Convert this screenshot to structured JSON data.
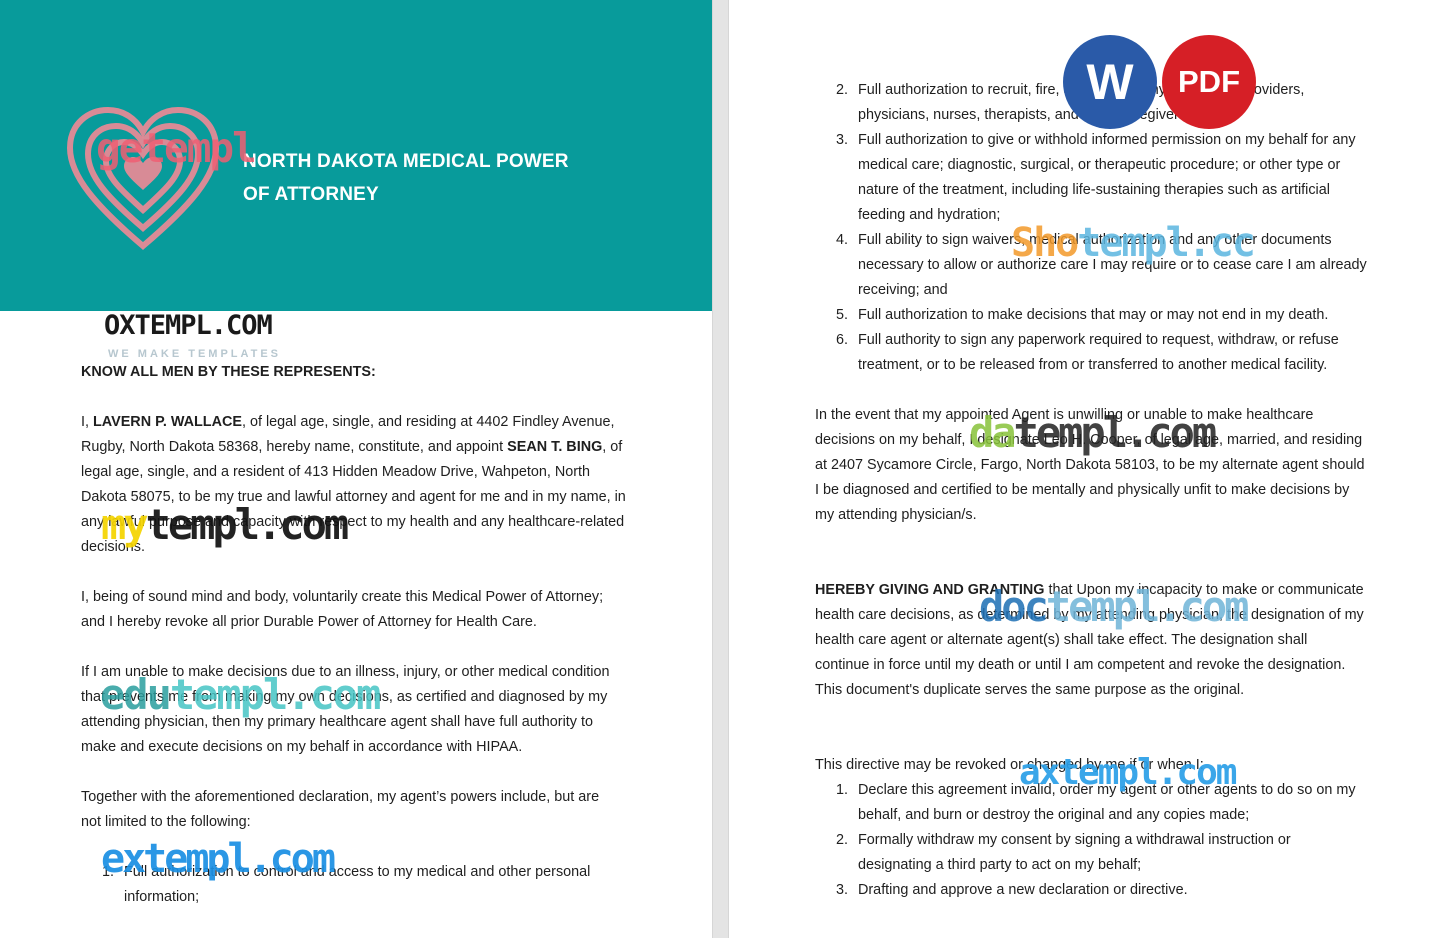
{
  "title": {
    "line1": "NORTH DAKOTA MEDICAL POWER",
    "line2": "OF ATTORNEY"
  },
  "left": {
    "heading": "KNOW ALL MEN BY THESE REPRESENTS:",
    "p1": {
      "a": "I, ",
      "principal": "LAVERN P. WALLACE",
      "b": ", of legal age, single, and residing at 4402 Findley Avenue, Rugby, North Dakota 58368, hereby name, constitute, and appoint ",
      "agent": "SEAN T. BING",
      "c": ", of legal age, single, and a resident of 413 Hidden Meadow Drive, Wahpeton, North Dakota 58075, to be my true and lawful attorney and agent for me and in my name, in any lawful purpose and capacity with respect to my health and any healthcare-related decisions."
    },
    "p2": "I, being of sound mind and body, voluntarily create this Medical Power of Attorney; and I hereby revoke all prior Durable Power of Attorney for Health Care.",
    "p3": "If I am unable to make decisions due to an illness, injury, or other medical condition that prevents me from making my own decisions, as certified and diagnosed by my attending physician, then my primary healthcare agent shall have full authority to make and execute decisions on my behalf in accordance with HIPAA.",
    "p4": "Together with the aforementioned declaration, my agent’s powers include, but are not limited to the following:",
    "list": [
      {
        "num": "1.",
        "text": "Full authorization to control and access to my medical and other personal information;"
      }
    ]
  },
  "right": {
    "list1": [
      {
        "num": "2.",
        "text": "Full authorization to recruit, fire, and oversee my healthcare providers, physicians, nurses, therapists, and other caregivers;"
      },
      {
        "num": "3.",
        "text": "Full authorization to give or withhold informed permission on my behalf for any medical care; diagnostic, surgical, or therapeutic procedure; or other type or nature of the treatment, including life-sustaining therapies such as artificial feeding and hydration;"
      },
      {
        "num": "4.",
        "text": "Full ability to sign waivers, medical authorization and any other documents necessary to allow or authorize care I may require or to cease care I am already receiving; and"
      },
      {
        "num": "5.",
        "text": "Full authorization to make decisions that may or may not end in my death."
      },
      {
        "num": "6.",
        "text": "Full authority to sign any paperwork required to request, withdraw, or refuse treatment, or to be released from or transferred to another medical facility."
      }
    ],
    "p5": "In the event that my appointed Agent is unwilling or unable to make healthcare decisions on my behalf, I designate Leo H. Cooper, of legal age, married, and residing at 2407 Sycamore Circle, Fargo, North Dakota 58103, to be my alternate agent should I be diagnosed and certified to be mentally and physically unfit to make decisions by my attending physician/s.",
    "p6": {
      "bold": "HEREBY GIVING AND GRANTING",
      "rest": " that Upon my incapacity to make or communicate health care decisions, as determined by my attending physician, the designation of my health care agent or alternate agent(s) shall take effect. The designation shall continue in force until my death or until I am competent and revoke the designation. This document's duplicate serves the same purpose as the original."
    },
    "p7": "This directive may be revoked or changed by me if or when I:",
    "list2": [
      {
        "num": "1.",
        "text": "Declare this agreement invalid, order my agent or other agents to do so on my behalf, and burn or destroy the original and any copies made;"
      },
      {
        "num": "2.",
        "text": "Formally withdraw my consent by signing a withdrawal instruction or designating a third party to act on my behalf;"
      },
      {
        "num": "3.",
        "text": "Drafting and approve a new declaration or directive."
      }
    ]
  },
  "watermarks": {
    "getempl": {
      "a": "ge",
      "b": "templ"
    },
    "oxtempl": "OXTEMPL.COM",
    "oxtempl_sub": "WE MAKE TEMPLATES",
    "mytempl": {
      "a": "my",
      "b": "templ.com"
    },
    "edutempl": {
      "a": "edu",
      "b": "templ.com"
    },
    "extempl": {
      "a": "ex",
      "b": "templ.com"
    },
    "shotempl": {
      "a": "Sho",
      "b": "templ.cc"
    },
    "datempl": {
      "a": "da",
      "b": "templ.com"
    },
    "doctempl": {
      "a": "doc",
      "b": "templ.com"
    },
    "axtempl": "axtempl.com"
  },
  "badges": {
    "word": "W",
    "pdf": "PDF"
  },
  "colors": {
    "header_teal": "#089b9b",
    "word_blue": "#2a5aa8",
    "pdf_red": "#d61f26"
  }
}
